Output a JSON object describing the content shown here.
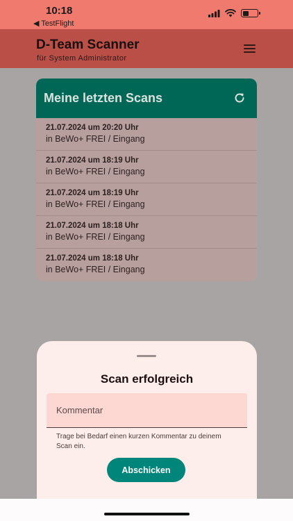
{
  "status_bar": {
    "time": "10:18",
    "back_label": "◀ TestFlight",
    "battery_level": 0.45
  },
  "header": {
    "title": "D-Team Scanner",
    "subtitle": "für System Administrator"
  },
  "scans": {
    "title": "Meine letzten Scans",
    "items": [
      {
        "date": "21.07.2024 um 20:20 Uhr",
        "place": "in BeWo+ FREI / Eingang"
      },
      {
        "date": "21.07.2024 um 18:19 Uhr",
        "place": "in BeWo+ FREI / Eingang"
      },
      {
        "date": "21.07.2024 um 18:19 Uhr",
        "place": "in BeWo+ FREI / Eingang"
      },
      {
        "date": "21.07.2024 um 18:18 Uhr",
        "place": "in BeWo+ FREI / Eingang"
      },
      {
        "date": "21.07.2024 um 18:18 Uhr",
        "place": "in BeWo+ FREI / Eingang"
      }
    ]
  },
  "sheet": {
    "title": "Scan erfolgreich",
    "comment_placeholder": "Kommentar",
    "comment_value": "",
    "helper": "Trage bei Bedarf einen kurzen Kommentar zu deinem Scan ein.",
    "submit_label": "Abschicken"
  },
  "colors": {
    "status_bar": "#f07a6e",
    "header": "#b94f46",
    "card_header": "#006757",
    "accent_button": "#00857a"
  }
}
